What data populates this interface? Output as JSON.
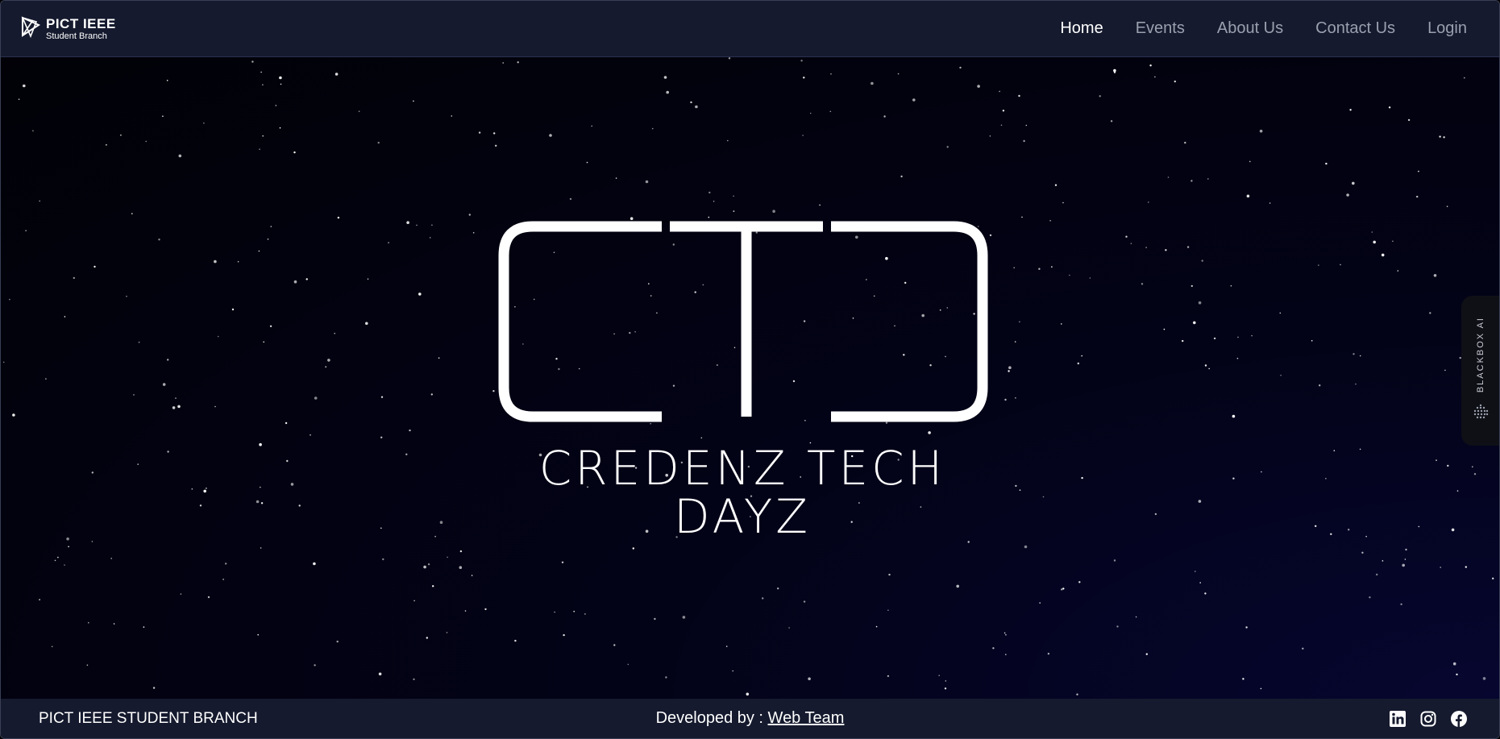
{
  "brand": {
    "title": "PICT IEEE",
    "subtitle": "Student Branch"
  },
  "nav": {
    "items": [
      {
        "label": "Home",
        "active": true
      },
      {
        "label": "Events",
        "active": false
      },
      {
        "label": "About Us",
        "active": false
      },
      {
        "label": "Contact Us",
        "active": false
      },
      {
        "label": "Login",
        "active": false
      }
    ]
  },
  "hero": {
    "logo_letters": "CTD",
    "logo_title": "CREDENZ TECH DAYZ"
  },
  "side_tab": {
    "label": "BLACKBOX AI"
  },
  "footer": {
    "left_text": "PICT IEEE STUDENT BRANCH",
    "developed_prefix": "Developed by : ",
    "developed_link": "Web Team",
    "social_icons": [
      "linkedin-icon",
      "instagram-icon",
      "facebook-icon"
    ]
  },
  "colors": {
    "nav_bg": "#151a2e",
    "hero_bg": "#010107",
    "accent": "#ffffff"
  }
}
